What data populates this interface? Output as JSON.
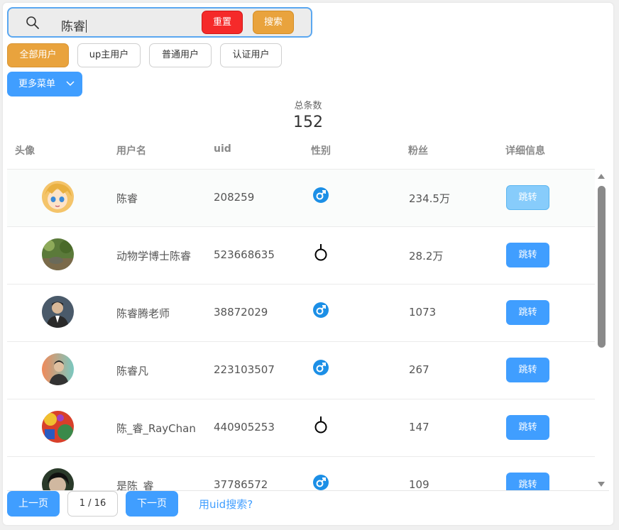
{
  "search": {
    "value": "陈睿",
    "reset_label": "重置",
    "search_label": "搜索"
  },
  "filters": [
    "全部用户",
    "up主用户",
    "普通用户",
    "认证用户"
  ],
  "more_menu_label": "更多菜单",
  "total": {
    "label": "总条数",
    "value": "152"
  },
  "columns": [
    "头像",
    "用户名",
    "uid",
    "性别",
    "粉丝",
    "详细信息"
  ],
  "rows": [
    {
      "name": "陈睿",
      "uid": "208259",
      "gender": "male",
      "fans": "234.5万",
      "action": "跳转"
    },
    {
      "name": "动物学博士陈睿",
      "uid": "523668635",
      "gender": "unknown",
      "fans": "28.2万",
      "action": "跳转"
    },
    {
      "name": "陈睿腾老师",
      "uid": "38872029",
      "gender": "male",
      "fans": "1073",
      "action": "跳转"
    },
    {
      "name": "陈睿凡",
      "uid": "223103507",
      "gender": "male",
      "fans": "267",
      "action": "跳转"
    },
    {
      "name": "陈_睿_RayChan",
      "uid": "440905253",
      "gender": "unknown",
      "fans": "147",
      "action": "跳转"
    },
    {
      "name": "是陈_睿",
      "uid": "37786572",
      "gender": "male",
      "fans": "109",
      "action": "跳转"
    }
  ],
  "pagination": {
    "prev_label": "上一页",
    "page_indicator": "1 / 16",
    "next_label": "下一页",
    "uid_search_label": "用uid搜索?"
  },
  "colors": {
    "primary": "#409eff",
    "accent": "#e9a33d",
    "danger": "#f52a2a",
    "male_icon": "#1c8fe6"
  }
}
